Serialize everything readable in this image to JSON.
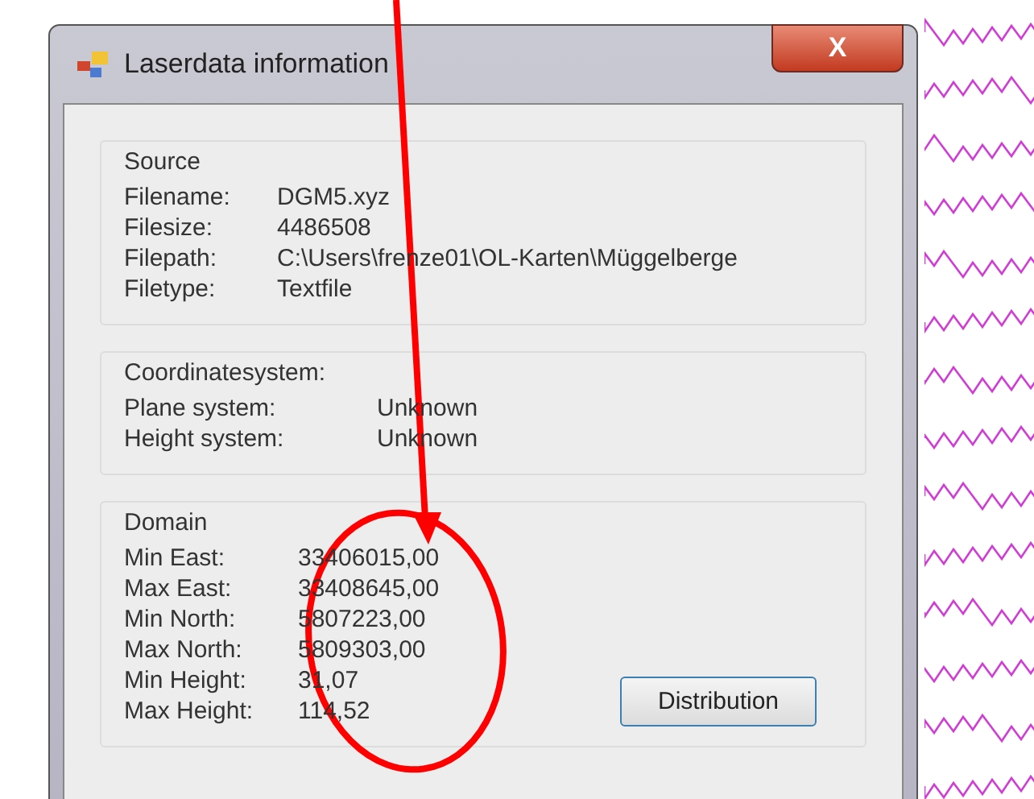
{
  "window": {
    "title": "Laserdata information",
    "close_label": "X"
  },
  "groups": [
    {
      "title": "Source",
      "rows": [
        {
          "label": "Filename:",
          "value": "DGM5.xyz"
        },
        {
          "label": "Filesize:",
          "value": "4486508"
        },
        {
          "label": "Filepath:",
          "value": "C:\\Users\\frenze01\\OL-Karten\\Müggelberge"
        },
        {
          "label": "Filetype:",
          "value": "Textfile"
        }
      ]
    },
    {
      "title": "Coordinatesystem:",
      "rows": [
        {
          "label": "Plane system:",
          "value": "Unknown"
        },
        {
          "label": "Height system:",
          "value": "Unknown"
        }
      ]
    },
    {
      "title": "Domain",
      "rows": [
        {
          "label": "Min East:",
          "value": "33406015,00"
        },
        {
          "label": "Max East:",
          "value": "33408645,00"
        },
        {
          "label": "Min North:",
          "value": "5807223,00"
        },
        {
          "label": "Max North:",
          "value": "5809303,00"
        },
        {
          "label": "Min Height:",
          "value": "31,07"
        },
        {
          "label": "Max Height:",
          "value": "114,52"
        }
      ],
      "button": "Distribution"
    }
  ]
}
